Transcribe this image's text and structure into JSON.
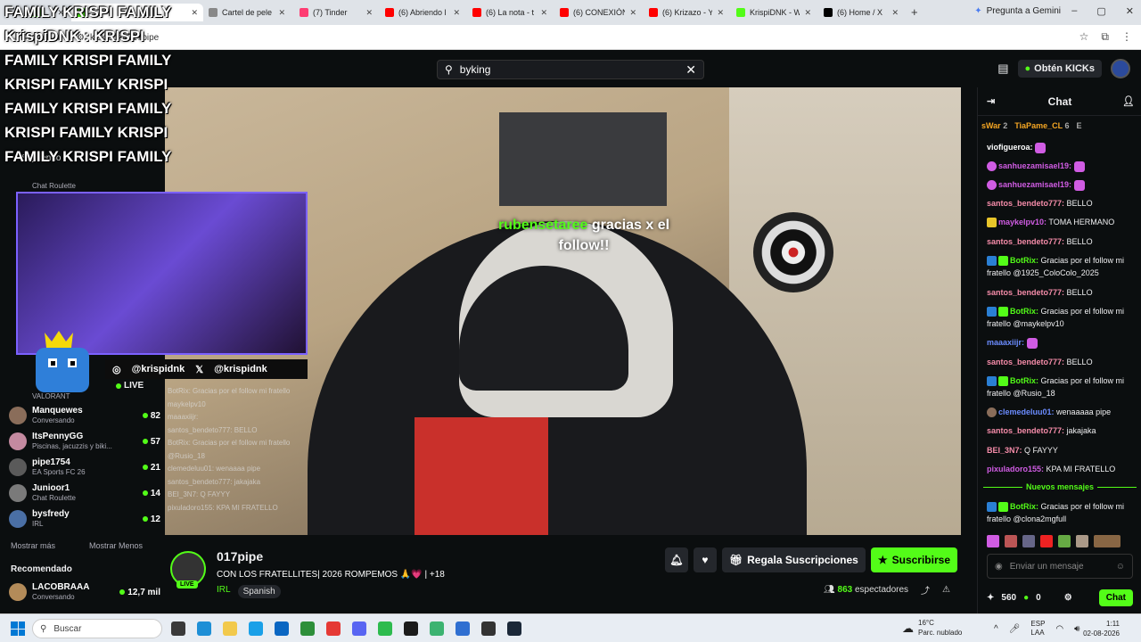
{
  "browser": {
    "tabs": [
      {
        "label": "",
        "color": "#53fc18"
      },
      {
        "label": "",
        "color": "#53fc18"
      },
      {
        "label": "Cartel de pele",
        "color": "#888888"
      },
      {
        "label": "(7) Tinder",
        "color": "#fe3c72"
      },
      {
        "label": "(6) Abriendo l",
        "color": "#ff0000"
      },
      {
        "label": "(6) La nota - t",
        "color": "#ff0000"
      },
      {
        "label": "(6) CONEXIÓN",
        "color": "#ff0000"
      },
      {
        "label": "(6) Krizazo - Y",
        "color": "#ff0000"
      },
      {
        "label": "KrispiDNK - W",
        "color": "#53fc18"
      },
      {
        "label": "(6) Home / X",
        "color": "#000000"
      }
    ],
    "new_tab": "+",
    "gemini": "Pregunta a Gemini",
    "url": "kick.com/017pipe"
  },
  "overlay_text": [
    "FAMILY KRISPI FAMILY",
    "KrispiDNK : KRISPI",
    "FAMILY KRISPI FAMILY",
    "KRISPI FAMILY KRISPI",
    "FAMILY KRISPI FAMILY",
    "KRISPI FAMILY KRISPI",
    "FAMILY KRISPI FAMILY"
  ],
  "search": {
    "value": "byking"
  },
  "topnav": {
    "kicks_label": "Obtén KICKs"
  },
  "sidebar": {
    "following_label": "Siguiendo",
    "top_cat": "Chat Roulette",
    "live_label": "LIVE",
    "live_cat": "VALORANT",
    "items": [
      {
        "name": "Manquewes",
        "cat": "Conversando",
        "viewers": "82",
        "color": "#8a6d5a"
      },
      {
        "name": "ItsPennyGG",
        "cat": "Piscinas, jacuzzis y biki...",
        "viewers": "57",
        "color": "#c48aa0"
      },
      {
        "name": "pipe1754",
        "cat": "EA Sports FC 26",
        "viewers": "21",
        "color": "#5a5a5a"
      },
      {
        "name": "Junioor1",
        "cat": "Chat Roulette",
        "viewers": "14",
        "color": "#7a7a7a"
      },
      {
        "name": "bysfredy",
        "cat": "IRL",
        "viewers": "12",
        "color": "#4a6fa5"
      }
    ],
    "show_more": "Mostrar más",
    "show_less": "Mostrar Menos",
    "recommended": "Recomendado",
    "rec_items": [
      {
        "name": "LACOBRAAA",
        "cat": "Conversando",
        "viewers": "12,7 mil",
        "color": "#b38b59"
      }
    ]
  },
  "video": {
    "follow_user": "rubensetaree",
    "follow_text": "gracias x el follow!!",
    "socials": [
      "@krispidnk",
      "@krispidnk"
    ],
    "overlay_chat": [
      "BotRix: Gracias por el follow mi fratello",
      "maykelpv10",
      "maaaxiijr:",
      "santos_bendeto777: BELLO",
      "BotRix: Gracias por el follow mi fratello",
      "@Rusio_18",
      "clemedeluu01: wenaaaa pipe",
      "santos_bendeto777: jakajaka",
      "BEI_3N7: Q FAYYY",
      "pixuladoro155: KPA MI FRATELLO"
    ]
  },
  "stream": {
    "channel": "017pipe",
    "live": "LIVE",
    "title": "CON LOS FRATELLITES| 2026 ROMPEMOS 🙏💗 | +18",
    "category": "IRL",
    "tag": "Spanish",
    "gift_label": "Regala Suscripciones",
    "subscribe_label": "Suscribirse",
    "viewers": "863",
    "viewers_label": "espectadores"
  },
  "chat": {
    "title": "Chat",
    "gifters": [
      {
        "name": "sWar",
        "count": "2"
      },
      {
        "name": "TiaPame_CL",
        "count": "6"
      },
      {
        "name": "E",
        "count": ""
      }
    ],
    "messages": [
      {
        "user": "viofigueroa:",
        "text": "",
        "color": "#ffffff"
      },
      {
        "user": "sanhuezamisael19:",
        "text": "",
        "color": "#d05ce3"
      },
      {
        "user": "sanhuezamisael19:",
        "text": "",
        "color": "#d05ce3"
      },
      {
        "user": "santos_bendeto777:",
        "text": "BELLO",
        "color": "#f58ca9"
      },
      {
        "user": "maykelpv10:",
        "text": "TOMA HERMANO",
        "color": "#d05ce3"
      },
      {
        "user": "santos_bendeto777:",
        "text": "BELLO",
        "color": "#f58ca9"
      },
      {
        "user": "BotRix:",
        "text": "Gracias por el follow mi fratello @1925_ColoColo_2025",
        "color": "#53fc18"
      },
      {
        "user": "santos_bendeto777:",
        "text": "BELLO",
        "color": "#f58ca9"
      },
      {
        "user": "BotRix:",
        "text": "Gracias por el follow mi fratello @maykelpv10",
        "color": "#53fc18"
      },
      {
        "user": "maaaxiijr:",
        "text": "",
        "color": "#6b8cff"
      },
      {
        "user": "santos_bendeto777:",
        "text": "BELLO",
        "color": "#f58ca9"
      },
      {
        "user": "BotRix:",
        "text": "Gracias por el follow mi fratello @Rusio_18",
        "color": "#53fc18"
      },
      {
        "user": "clemedeluu01:",
        "text": "wenaaaaa pipe",
        "color": "#6b8cff"
      },
      {
        "user": "santos_bendeto777:",
        "text": "jakajaka",
        "color": "#f58ca9"
      },
      {
        "user": "BEI_3N7:",
        "text": "Q FAYYY",
        "color": "#f58ca9"
      },
      {
        "user": "pixuladoro155:",
        "text": "KPA MI FRATELLO",
        "color": "#d05ce3"
      }
    ],
    "new_messages": "Nuevos mensajes",
    "last_message": {
      "user": "BotRix:",
      "text": "Gracias por el follow mi fratello @clona2mgfull",
      "color": "#53fc18"
    },
    "input_placeholder": "Enviar un mensaje",
    "points": "560",
    "kicks": "0",
    "send_label": "Chat"
  },
  "taskbar": {
    "search_placeholder": "Buscar",
    "weather_temp": "16°C",
    "weather_desc": "Parc. nublado",
    "lang": "ESP",
    "lang2": "LAA",
    "time": "1:11",
    "date": "02-08-2026"
  }
}
